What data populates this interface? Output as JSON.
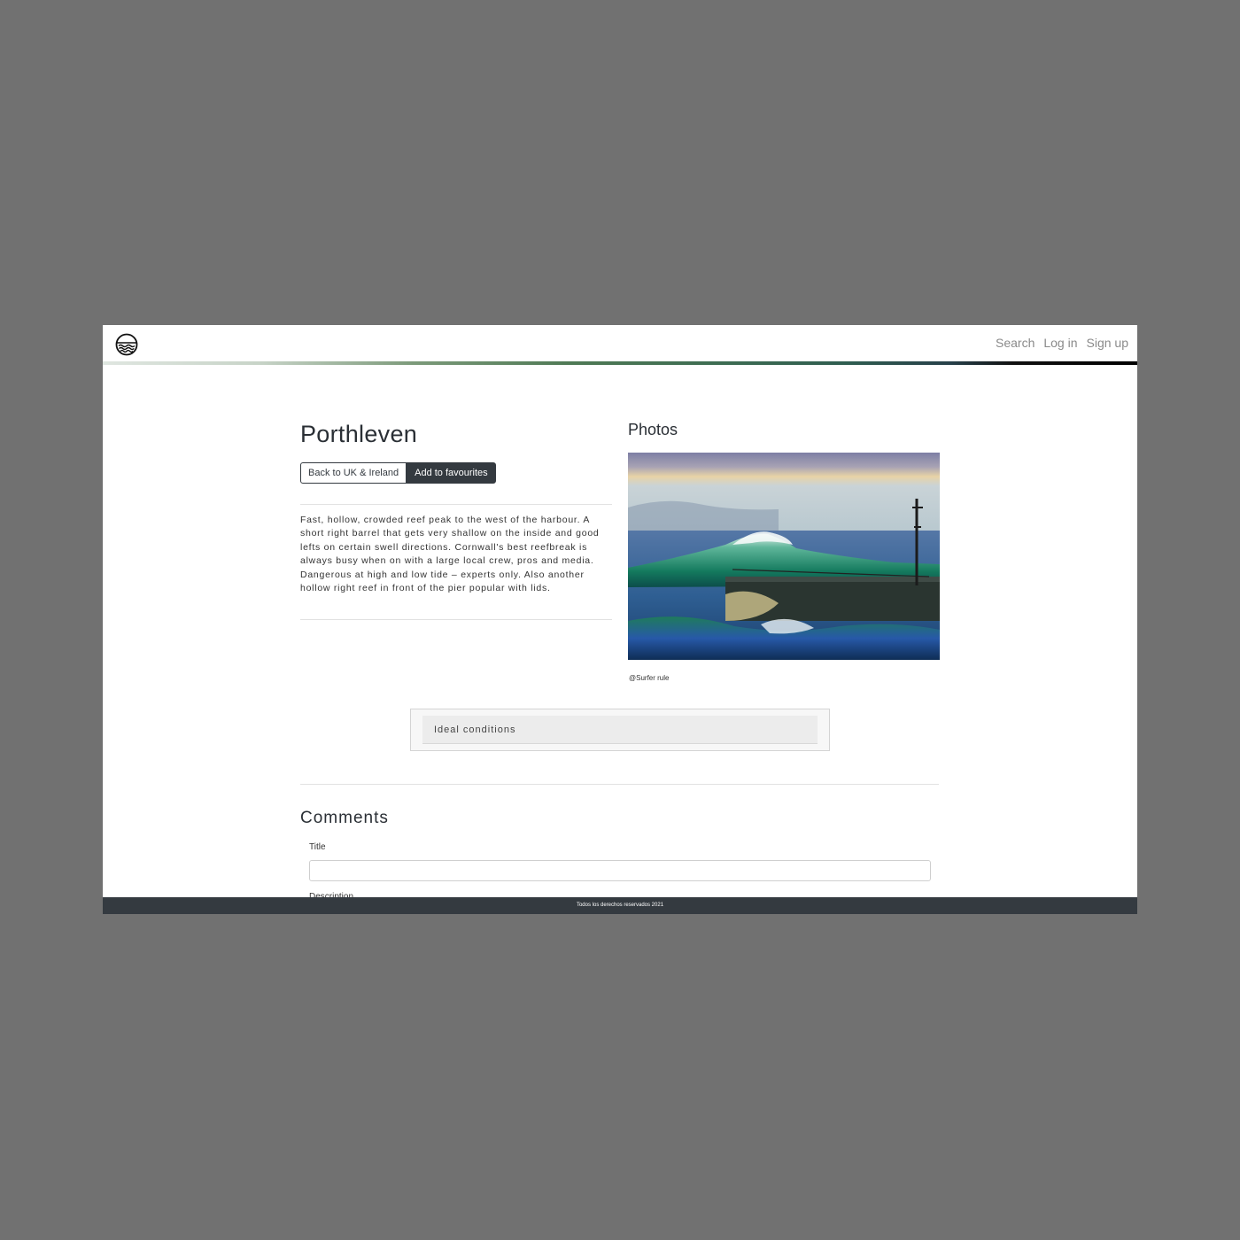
{
  "navbar": {
    "logo_icon": "wave-circle-icon",
    "links": {
      "search": "Search",
      "login": "Log in",
      "signup": "Sign up"
    }
  },
  "spot": {
    "name": "Porthleven",
    "back_label": "Back to UK & Ireland",
    "favourite_label": "Add to favourites",
    "description": "Fast, hollow, crowded reef peak to the west of the harbour. A short right barrel that gets very shallow on the inside and good lefts on certain swell directions. Cornwall's best reefbreak is always busy when on with a large local crew, pros and media. Dangerous at high and low tide – experts only. Also another hollow right reef in front of the pier popular with lids."
  },
  "photos": {
    "heading": "Photos",
    "credit": "@Surfer rule"
  },
  "conditions": {
    "header": "Ideal conditions"
  },
  "comments": {
    "heading": "Comments",
    "title_label": "Title",
    "title_value": "",
    "description_label": "Description"
  },
  "footer": {
    "text": "Todos los derechos reservados 2021"
  },
  "colors": {
    "dark": "#343a40",
    "background": "#717171",
    "nav_link": "#8a8a8a"
  }
}
